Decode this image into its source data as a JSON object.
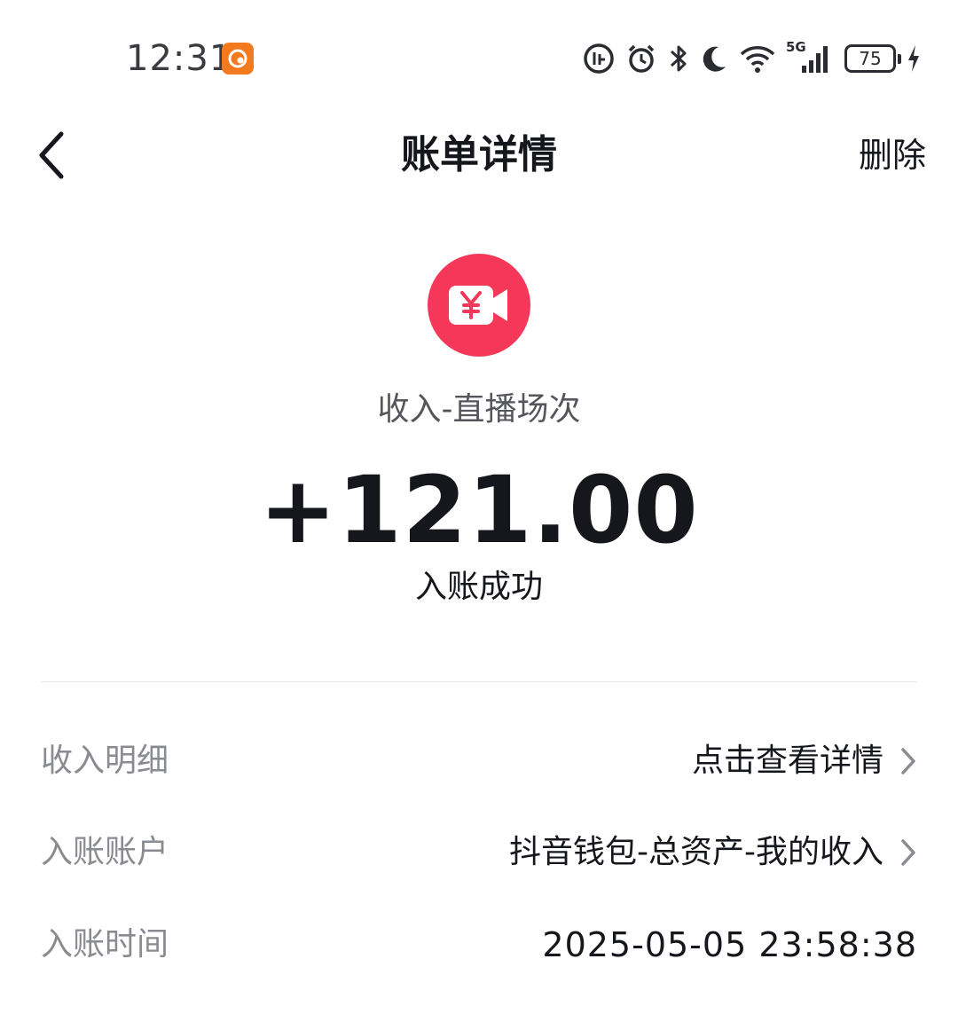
{
  "status_bar": {
    "time": "12:31",
    "network": "5G",
    "battery_level": "75",
    "icons": [
      "app-notification-icon",
      "data-saver-icon",
      "alarm-icon",
      "bluetooth-icon",
      "moon-icon",
      "wifi-icon",
      "signal-icon",
      "battery-icon",
      "charging-icon"
    ]
  },
  "nav": {
    "back_icon": "chevron-left-icon",
    "title": "账单详情",
    "delete_label": "删除"
  },
  "bill": {
    "icon": "yuan-video-icon",
    "icon_color": "#f5385a",
    "category": "收入-直播场次",
    "amount": "+121.00",
    "status": "入账成功"
  },
  "details": [
    {
      "label": "收入明细",
      "value": "点击查看详情",
      "has_chevron": true
    },
    {
      "label": "入账账户",
      "value": "抖音钱包-总资产-我的收入",
      "has_chevron": true
    },
    {
      "label": "入账时间",
      "value": "2025-05-05 23:58:38",
      "has_chevron": false
    }
  ]
}
